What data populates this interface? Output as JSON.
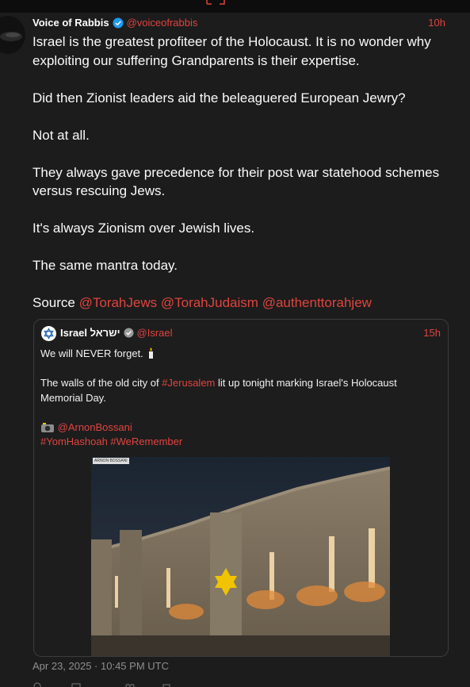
{
  "tweet": {
    "author_name": "Voice of Rabbis",
    "handle": "@voiceofrabbis",
    "time": "10h",
    "paragraphs": [
      "Israel is the greatest profiteer of the Holocaust. It is no wonder why exploiting our suffering Grandparents is their expertise.",
      "Did then Zionist leaders aid the beleaguered European Jewry?",
      "Not at all.",
      "They always gave precedence for their post war statehood schemes versus rescuing Jews.",
      "It's always Zionism over Jewish lives.",
      "The same mantra today."
    ],
    "source_label": "Source",
    "source_mentions": [
      "@TorahJews",
      "@TorahJudaism",
      "@authenttorahjew"
    ],
    "date": "Apr 23, 2025 · 10:45 PM UTC"
  },
  "quote": {
    "author_name": "Israel ישראל",
    "handle": "@Israel",
    "time": "15h",
    "line1": "We will NEVER forget.",
    "line2_pre": "The walls of the old city of ",
    "line2_tag": "#Jerusalem",
    "line2_post": " lit up tonight marking Israel's Holocaust Memorial Day.",
    "photo_credit": "@ArnonBossani",
    "hashtags": "#YomHashoah #WeRemember",
    "image_watermark": "ARNON BOSSANI"
  },
  "colors": {
    "background": "#1c1c1c",
    "accent": "#e0443f",
    "text": "#f2f2f2",
    "muted": "#8e8e8e",
    "verified_blue": "#1d9bf0"
  },
  "icons": [
    "verified-badge-icon",
    "gold-check-icon",
    "star-of-david-icon",
    "candle-emoji-icon",
    "camera-emoji-icon"
  ]
}
